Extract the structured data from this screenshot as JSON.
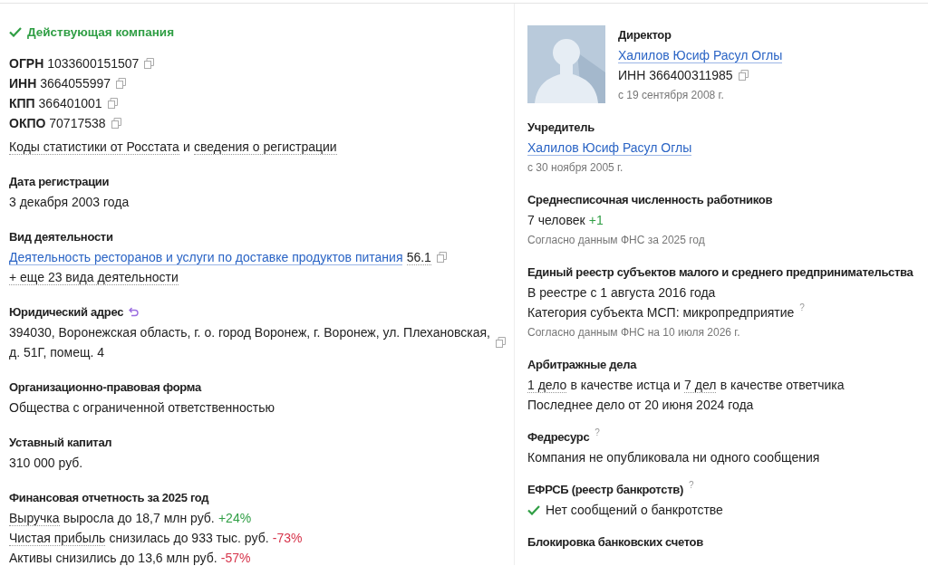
{
  "status": {
    "text": "Действующая компания",
    "active": true
  },
  "identifiers": [
    {
      "label": "ОГРН",
      "value": "1033600151507"
    },
    {
      "label": "ИНН",
      "value": "3664055997"
    },
    {
      "label": "КПП",
      "value": "366401001"
    },
    {
      "label": "ОКПО",
      "value": "70717538"
    }
  ],
  "stats_line": [
    {
      "t": "Коды статистики от Росстата",
      "kind": "dotted"
    },
    {
      "t": "и",
      "kind": "plain"
    },
    {
      "t": "сведения о регистрации",
      "kind": "dotted"
    }
  ],
  "left_sections": [
    {
      "title": "Дата регистрации",
      "lines": [
        {
          "kind": "text",
          "segments": [
            {
              "t": "3 декабря 2003 года",
              "kind": "plain"
            }
          ]
        }
      ]
    },
    {
      "title": "Вид деятельности",
      "lines": [
        {
          "kind": "text",
          "copy": true,
          "segments": [
            {
              "t": "Деятельность ресторанов и услуги по доставке продуктов питания",
              "kind": "link"
            },
            {
              "t": "56.1",
              "kind": "dotted"
            }
          ]
        },
        {
          "kind": "text",
          "segments": [
            {
              "t": "+ еще 23 вида деятельности",
              "kind": "dotted"
            }
          ]
        }
      ]
    },
    {
      "title": "Юридический адрес",
      "history": true,
      "lines": [
        {
          "kind": "text",
          "copy": true,
          "segments": [
            {
              "t": "394030, Воронежская область, г. о. город Воронеж, г. Воронеж, ул. Плехановская, д. 51Г, помещ. 4",
              "kind": "plain"
            }
          ]
        }
      ]
    },
    {
      "title": "Организационно-правовая форма",
      "lines": [
        {
          "kind": "text",
          "segments": [
            {
              "t": "Общества с ограниченной ответственностью",
              "kind": "plain"
            }
          ]
        }
      ]
    },
    {
      "title": "Уставный капитал",
      "lines": [
        {
          "kind": "text",
          "segments": [
            {
              "t": "310 000 руб.",
              "kind": "plain"
            }
          ]
        }
      ]
    },
    {
      "title": "Финансовая отчетность за 2025 год",
      "lines": [
        {
          "kind": "text",
          "segments": [
            {
              "t": "Выручка",
              "kind": "dotted"
            },
            {
              "t": "выросла до 18,7 млн руб.",
              "kind": "plain"
            },
            {
              "t": "+24%",
              "kind": "up"
            }
          ]
        },
        {
          "kind": "text",
          "segments": [
            {
              "t": "Чистая прибыль",
              "kind": "dotted"
            },
            {
              "t": "снизилась до 933 тыс. руб.",
              "kind": "plain"
            },
            {
              "t": "-73%",
              "kind": "down"
            }
          ]
        },
        {
          "kind": "text",
          "segments": [
            {
              "t": "Активы",
              "kind": "dotted"
            },
            {
              "t": "снизились до 13,6 млн руб.",
              "kind": "plain"
            },
            {
              "t": "-57%",
              "kind": "down"
            }
          ]
        }
      ]
    }
  ],
  "director": {
    "title": "Директор",
    "lines": [
      {
        "kind": "text",
        "segments": [
          {
            "t": "Халилов Юсиф Расул Оглы",
            "kind": "link"
          }
        ]
      },
      {
        "kind": "text",
        "copy": true,
        "segments": [
          {
            "t": "ИНН 366400311985",
            "kind": "plain"
          }
        ]
      },
      {
        "kind": "note",
        "text": "с 19 сентября 2008 г."
      }
    ]
  },
  "right_sections": [
    {
      "title": "Учредитель",
      "lines": [
        {
          "kind": "text",
          "segments": [
            {
              "t": "Халилов Юсиф Расул Оглы",
              "kind": "link"
            }
          ]
        },
        {
          "kind": "note",
          "text": "с 30 ноября 2005 г."
        }
      ]
    },
    {
      "title": "Среднесписочная численность работников",
      "lines": [
        {
          "kind": "text",
          "segments": [
            {
              "t": "7 человек",
              "kind": "plain"
            },
            {
              "t": "+1",
              "kind": "up"
            }
          ]
        },
        {
          "kind": "note",
          "text": "Согласно данным ФНС за 2025 год"
        }
      ]
    },
    {
      "title": "Единый реестр субъектов малого и среднего предпринимательства",
      "lines": [
        {
          "kind": "text",
          "segments": [
            {
              "t": "В реестре с 1 августа 2016 года",
              "kind": "plain"
            }
          ]
        },
        {
          "kind": "text",
          "help": "?",
          "segments": [
            {
              "t": "Категория субъекта МСП: микропредприятие",
              "kind": "plain"
            }
          ]
        },
        {
          "kind": "note",
          "text": "Согласно данным ФНС на 10 июля 2026 г."
        }
      ]
    },
    {
      "title": "Арбитражные дела",
      "lines": [
        {
          "kind": "text",
          "segments": [
            {
              "t": "1 дело",
              "kind": "dotted"
            },
            {
              "t": "в качестве истца и",
              "kind": "plain"
            },
            {
              "t": "7 дел",
              "kind": "dotted"
            },
            {
              "t": "в качестве ответчика",
              "kind": "plain"
            }
          ]
        },
        {
          "kind": "text",
          "segments": [
            {
              "t": "Последнее дело от 20 июня 2024 года",
              "kind": "plain"
            }
          ]
        }
      ]
    },
    {
      "title": "Федресурс",
      "help": "?",
      "lines": [
        {
          "kind": "text",
          "segments": [
            {
              "t": "Компания не опубликовала ни одного сообщения",
              "kind": "plain"
            }
          ]
        }
      ]
    },
    {
      "title": "ЕФРСБ (реестр банкротств)",
      "help": "?",
      "lines": [
        {
          "kind": "text",
          "check": true,
          "segments": [
            {
              "t": "Нет сообщений о банкротстве",
              "kind": "plain"
            }
          ]
        }
      ]
    },
    {
      "title": "Блокировка банковских счетов"
    }
  ]
}
